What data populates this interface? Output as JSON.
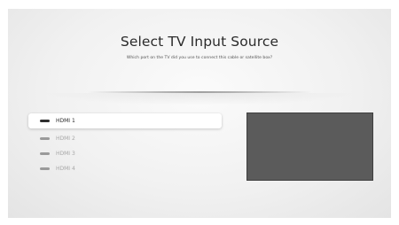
{
  "header": {
    "title": "Select TV Input Source",
    "subtitle": "Which port on the TV did you use to connect this cable or satellite box?"
  },
  "sources": [
    {
      "label": "HDMI 1",
      "selected": true
    },
    {
      "label": "HDMI 2",
      "selected": false
    },
    {
      "label": "HDMI 3",
      "selected": false
    },
    {
      "label": "HDMI 4",
      "selected": false
    }
  ],
  "preview": {
    "color": "#5b5b5b"
  }
}
